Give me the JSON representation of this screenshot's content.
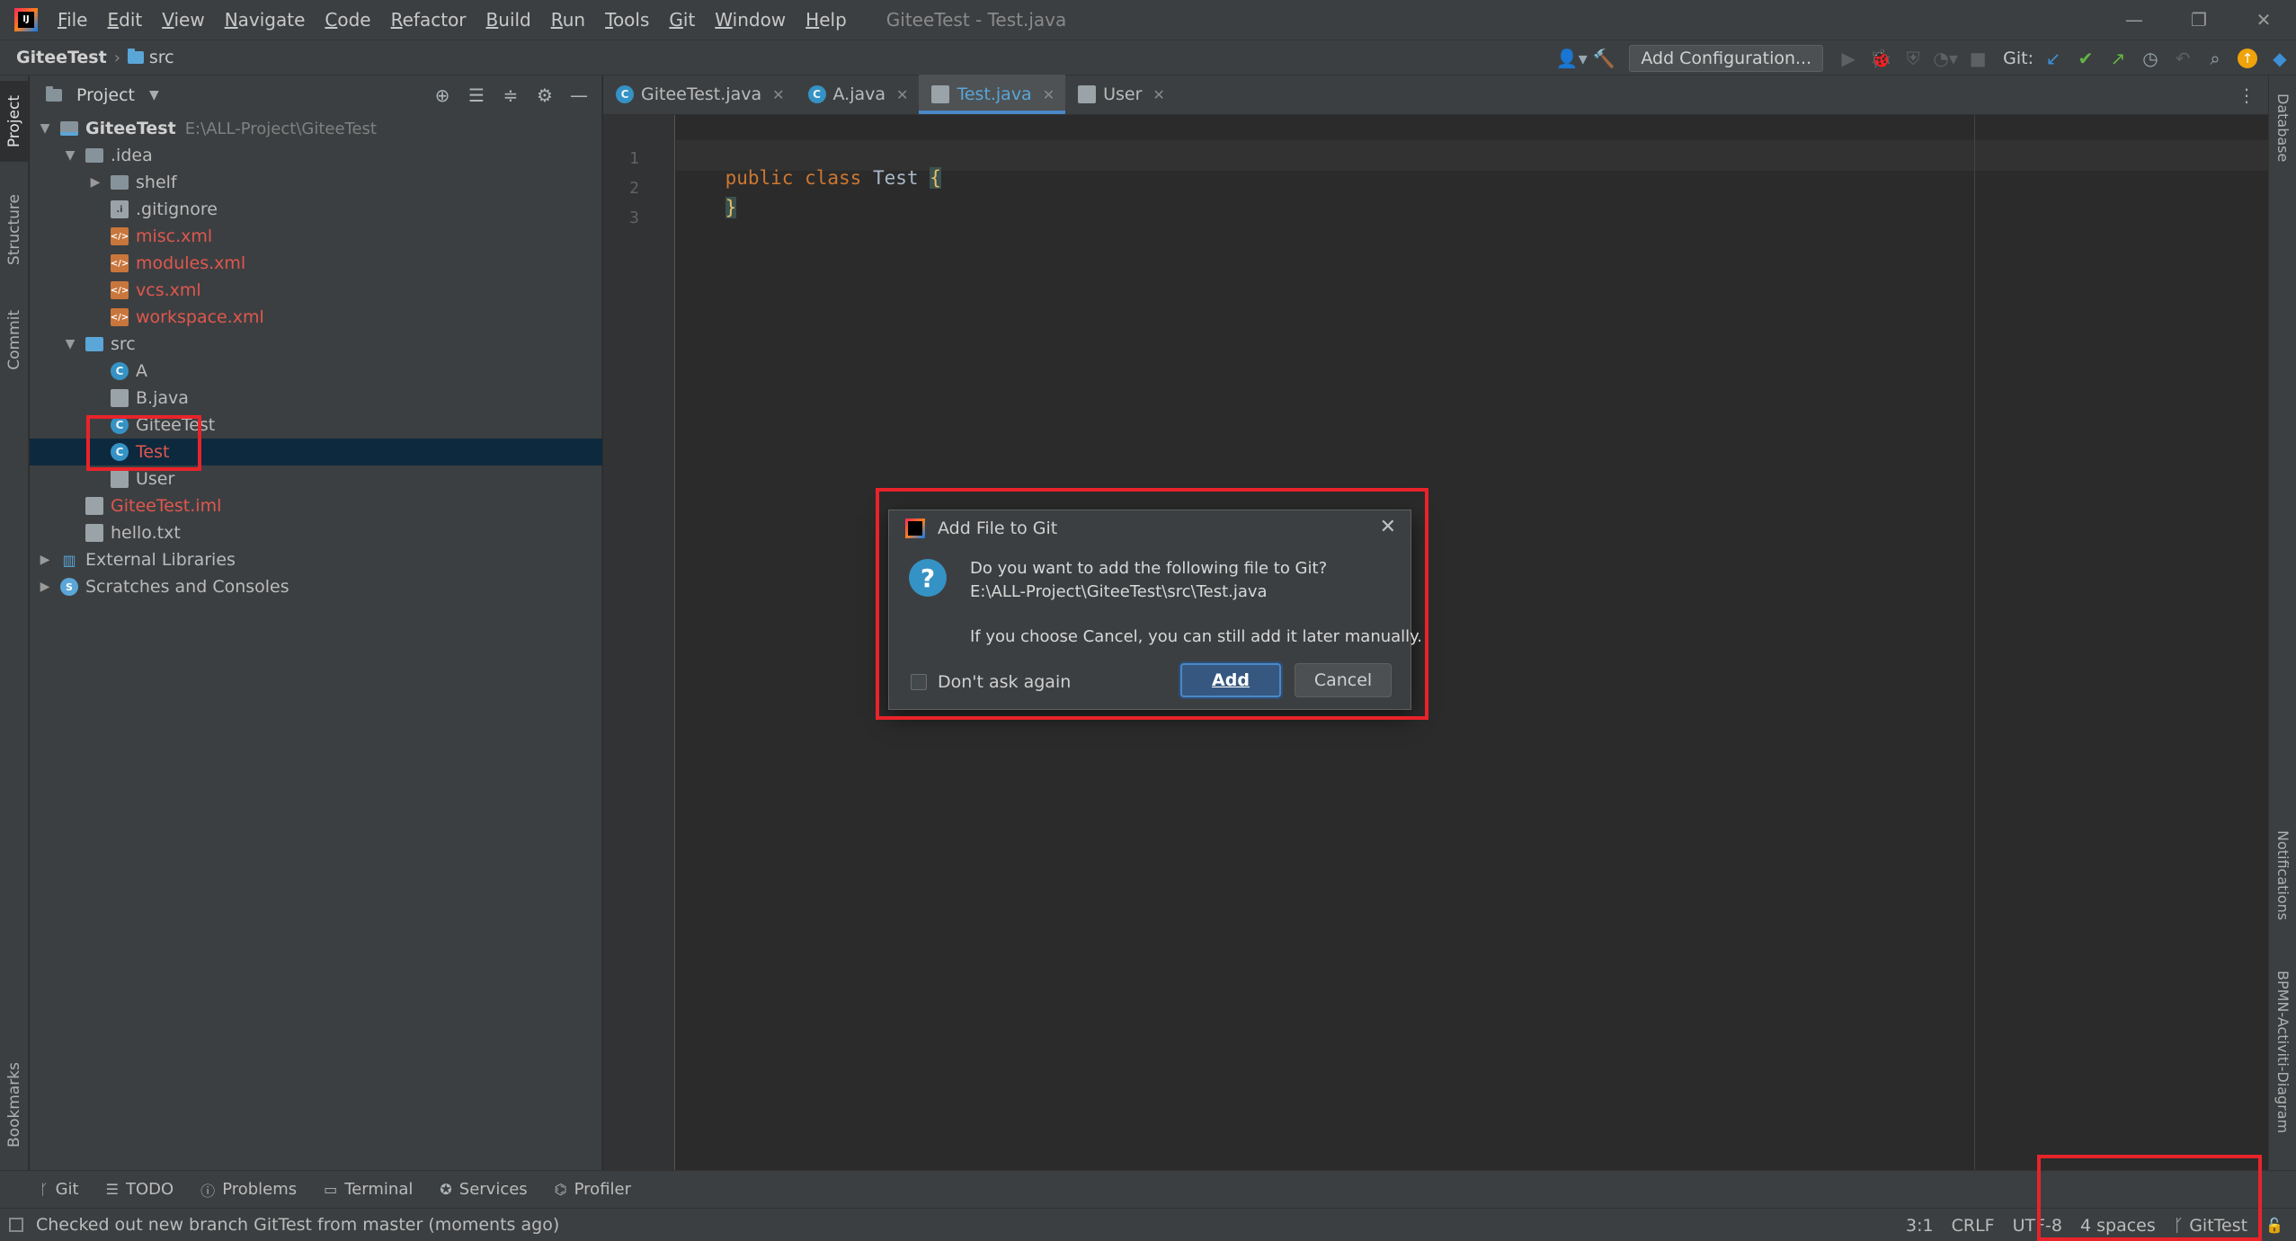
{
  "window": {
    "title": "GiteeTest - Test.java",
    "menu": [
      {
        "mnemonic": "F",
        "rest": "ile"
      },
      {
        "mnemonic": "E",
        "rest": "dit"
      },
      {
        "mnemonic": "V",
        "rest": "iew"
      },
      {
        "mnemonic": "N",
        "rest": "avigate"
      },
      {
        "mnemonic": "C",
        "rest": "ode"
      },
      {
        "mnemonic": "R",
        "rest": "efactor"
      },
      {
        "mnemonic": "B",
        "rest": "uild"
      },
      {
        "mnemonic": "R",
        "rest": "un"
      },
      {
        "mnemonic": "T",
        "rest": "ools"
      },
      {
        "mnemonic": "G",
        "rest": "it"
      },
      {
        "mnemonic": "W",
        "rest": "indow"
      },
      {
        "mnemonic": "H",
        "rest": "elp"
      }
    ],
    "controls": {
      "minimize": "—",
      "restore": "❐",
      "close": "✕"
    }
  },
  "navbar": {
    "project": "GiteeTest",
    "separator": "›",
    "folder": "src",
    "add_configuration": "Add Configuration...",
    "git_label": "Git:"
  },
  "left_tabs": [
    "Project",
    "Structure",
    "Commit",
    "Bookmarks"
  ],
  "right_tabs": [
    "Database",
    "Notifications",
    "BPMN-Activiti-Diagram"
  ],
  "project_panel": {
    "title": "Project",
    "caret": "▼",
    "tree": {
      "root": {
        "name": "GiteeTest",
        "path": "E:\\ALL-Project\\GiteeTest"
      },
      "idea": ".idea",
      "shelf": "shelf",
      "gitignore": ".gitignore",
      "misc": "misc.xml",
      "modules": "modules.xml",
      "vcs": "vcs.xml",
      "workspace": "workspace.xml",
      "src": "src",
      "a": "A",
      "b": "B.java",
      "giteetest": "GiteeTest",
      "test": "Test",
      "user": "User",
      "iml": "GiteeTest.iml",
      "hello": "hello.txt",
      "external": "External Libraries",
      "scratches": "Scratches and Consoles"
    }
  },
  "editor": {
    "tabs": [
      {
        "label": "GiteeTest.java"
      },
      {
        "label": "A.java"
      },
      {
        "label": "Test.java"
      },
      {
        "label": "User"
      }
    ],
    "line_numbers": [
      "1",
      "2",
      "3"
    ],
    "code": {
      "kw1": "public",
      "kw2": "class",
      "name": "Test",
      "open": "{",
      "close": "}"
    }
  },
  "dialog": {
    "title": "Add File to Git",
    "question": "Do you want to add the following file to Git?",
    "file_path": "E:\\ALL-Project\\GiteeTest\\src\\Test.java",
    "hint": "If you choose Cancel, you can still add it later manually.",
    "checkbox_label": "Don't ask again",
    "add_button": "Add",
    "cancel_button": "Cancel"
  },
  "tool_windows": [
    "Git",
    "TODO",
    "Problems",
    "Terminal",
    "Services",
    "Profiler"
  ],
  "status": {
    "message": "Checked out new branch GitTest from master (moments ago)",
    "position": "3:1",
    "line_sep": "CRLF",
    "encoding": "UTF-8",
    "indent": "4 spaces",
    "branch": "GitTest"
  },
  "colors": {
    "accent": "#4a88c7",
    "annotation": "#e8232a",
    "modified_file": "#e0574f",
    "selection": "#0d293e"
  }
}
